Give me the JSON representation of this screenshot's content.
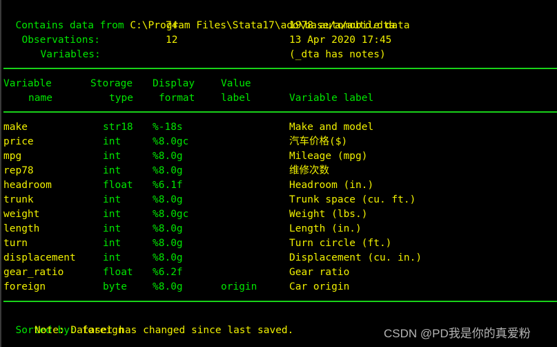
{
  "describe_output": {
    "header": {
      "contains_label": "Contains data from",
      "file_path": "C:\\Program Files\\Stata17\\ado\\base/a/auto.dta",
      "observations_label": "Observations:",
      "observations_value": "74",
      "variables_label": "Variables:",
      "variables_value": "12",
      "dataset_label": "1978 automobile data",
      "timestamp": "13 Apr 2020 17:45",
      "notes_flag": "(_dta has notes)"
    },
    "columns": {
      "variable": [
        "Variable",
        "name"
      ],
      "storage": [
        "Storage",
        "type"
      ],
      "display": [
        "Display",
        "format"
      ],
      "value": [
        "Value",
        "label"
      ],
      "var_label": [
        "",
        "Variable label"
      ]
    },
    "variables": [
      {
        "name": "make",
        "type": "str18",
        "format": "%-18s",
        "value_label": "",
        "label": "Make and model"
      },
      {
        "name": "price",
        "type": "int",
        "format": "%8.0gc",
        "value_label": "",
        "label": "汽车价格($)"
      },
      {
        "name": "mpg",
        "type": "int",
        "format": "%8.0g",
        "value_label": "",
        "label": "Mileage (mpg)"
      },
      {
        "name": "rep78",
        "type": "int",
        "format": "%8.0g",
        "value_label": "",
        "label": "维修次数"
      },
      {
        "name": "headroom",
        "type": "float",
        "format": "%6.1f",
        "value_label": "",
        "label": "Headroom (in.)"
      },
      {
        "name": "trunk",
        "type": "int",
        "format": "%8.0g",
        "value_label": "",
        "label": "Trunk space (cu. ft.)"
      },
      {
        "name": "weight",
        "type": "int",
        "format": "%8.0gc",
        "value_label": "",
        "label": "Weight (lbs.)"
      },
      {
        "name": "length",
        "type": "int",
        "format": "%8.0g",
        "value_label": "",
        "label": "Length (in.)"
      },
      {
        "name": "turn",
        "type": "int",
        "format": "%8.0g",
        "value_label": "",
        "label": "Turn circle (ft.)"
      },
      {
        "name": "displacement",
        "type": "int",
        "format": "%8.0g",
        "value_label": "",
        "label": "Displacement (cu. in.)"
      },
      {
        "name": "gear_ratio",
        "type": "float",
        "format": "%6.2f",
        "value_label": "",
        "label": "Gear ratio"
      },
      {
        "name": "foreign",
        "type": "byte",
        "format": "%8.0g",
        "value_label": "origin",
        "label": "Car origin"
      }
    ],
    "footer": {
      "sorted_label": "Sorted by:",
      "sorted_value": "foreign",
      "note": "Note: Dataset has changed since last saved."
    }
  },
  "watermark": "CSDN @PD我是你的真爱粉",
  "colors": {
    "background": "#000000",
    "result_text": "#f0f000",
    "label_text": "#00e600",
    "rule": "#19d219",
    "watermark": "#b4b4b4"
  }
}
